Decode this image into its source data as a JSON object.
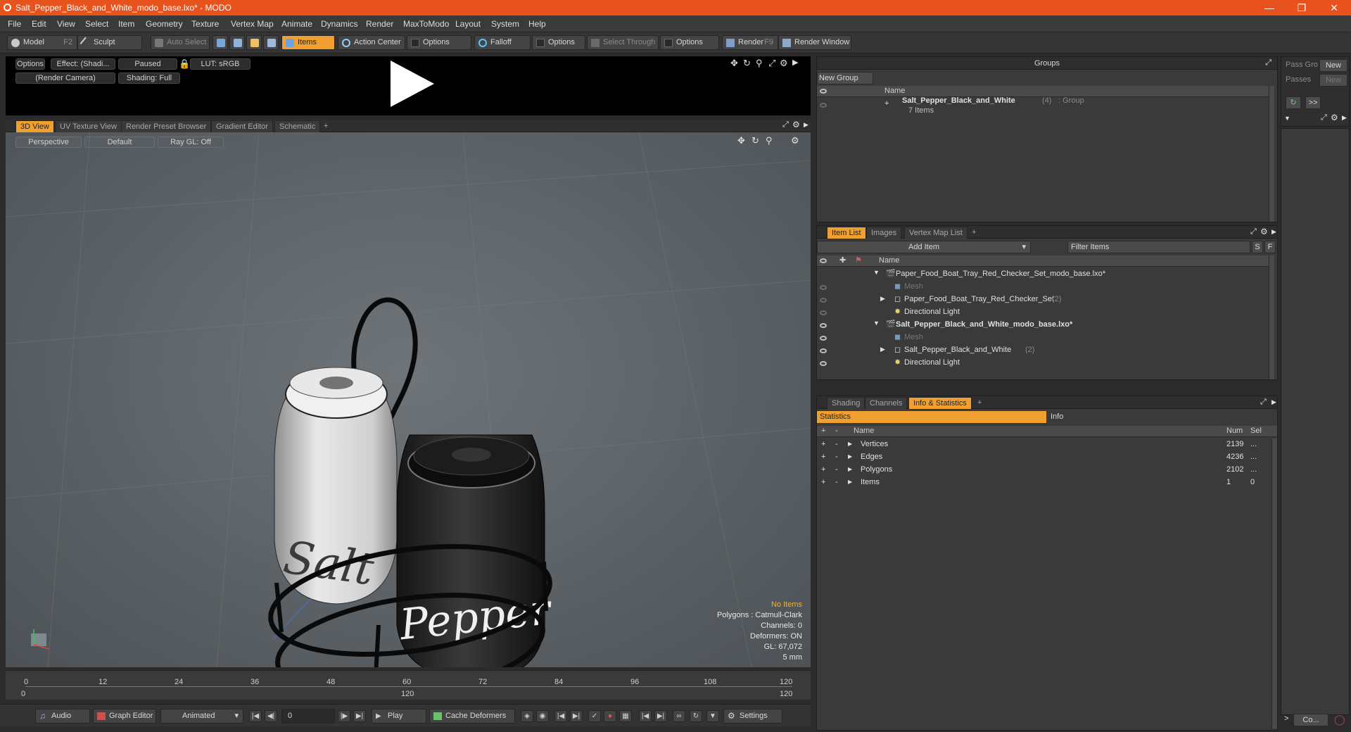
{
  "window": {
    "title": "Salt_Pepper_Black_and_White_modo_base.lxo* - MODO",
    "minimize": "—",
    "maximize": "❐",
    "close": "✕"
  },
  "menu": [
    "File",
    "Edit",
    "View",
    "Select",
    "Item",
    "Geometry",
    "Texture",
    "Vertex Map",
    "Animate",
    "Dynamics",
    "Render",
    "MaxToModo",
    "Layout",
    "System",
    "Help"
  ],
  "toolbar": {
    "model": "Model",
    "model_key": "F2",
    "sculpt": "Sculpt",
    "auto_select": "Auto Select",
    "items": "Items",
    "action_center": "Action Center",
    "options1": "Options",
    "falloff": "Falloff",
    "options2": "Options",
    "select_through": "Select Through",
    "options3": "Options",
    "render": "Render",
    "render_key": "F9",
    "render_window": "Render Window"
  },
  "preview": {
    "options": "Options",
    "effect": "Effect: (Shadi...",
    "paused": "Paused",
    "lut": "LUT: sRGB",
    "camera": "(Render Camera)",
    "shading": "Shading: Full"
  },
  "viewport_tabs": [
    "3D View",
    "UV Texture View",
    "Render Preset Browser",
    "Gradient Editor",
    "Schematic",
    "+"
  ],
  "viewport": {
    "perspective": "Perspective",
    "default": "Default",
    "raygl": "Ray GL: Off",
    "label_salt": "Salt",
    "label_pepper": "Pepper",
    "info": {
      "no_items": "No Items",
      "polygons": "Polygons : Catmull-Clark",
      "channels": "Channels: 0",
      "deformers": "Deformers: ON",
      "gl": "GL: 67,072",
      "unit": "5 mm"
    }
  },
  "timeline": {
    "ticks": [
      "0",
      "12",
      "24",
      "36",
      "48",
      "60",
      "72",
      "84",
      "96",
      "108",
      "120"
    ],
    "sub_left": "0",
    "sub_mid": "120",
    "sub_right": "120"
  },
  "bottombar": {
    "audio": "Audio",
    "graph_editor": "Graph Editor",
    "animated": "Animated",
    "frame": "0",
    "play": "Play",
    "cache_deformers": "Cache Deformers",
    "settings": "Settings"
  },
  "groups": {
    "title": "Groups",
    "new_group": "New Group",
    "col_name": "Name",
    "row_name": "Salt_Pepper_Black_and_White",
    "row_count": "(4)",
    "row_type": ": Group",
    "row_sub": "7 Items"
  },
  "pass": {
    "pass_groups": "Pass Gro",
    "passes": "Passes",
    "new1": "New",
    "new2": "New",
    "more": ">>"
  },
  "itemlist": {
    "tabs": [
      "Item List",
      "Images",
      "Vertex Map List",
      "+"
    ],
    "add_item": "Add Item",
    "filter": "Filter Items",
    "s": "S",
    "f": "F",
    "col_name": "Name",
    "rows": [
      {
        "label": "Paper_Food_Boat_Tray_Red_Checker_Set_modo_base.lxo*",
        "indent": 0,
        "bold": false,
        "dim": false,
        "arrow": "▼"
      },
      {
        "label": "Mesh",
        "indent": 1,
        "bold": false,
        "dim": true,
        "arrow": ""
      },
      {
        "label": "Paper_Food_Boat_Tray_Red_Checker_Set",
        "count": "(2)",
        "indent": 1,
        "bold": false,
        "dim": false,
        "arrow": "▶"
      },
      {
        "label": "Directional Light",
        "indent": 1,
        "bold": false,
        "dim": false,
        "arrow": ""
      },
      {
        "label": "Salt_Pepper_Black_and_White_modo_base.lxo*",
        "indent": 0,
        "bold": true,
        "dim": false,
        "arrow": "▼"
      },
      {
        "label": "Mesh",
        "indent": 1,
        "bold": false,
        "dim": true,
        "arrow": ""
      },
      {
        "label": "Salt_Pepper_Black_and_White",
        "count": "(2)",
        "indent": 1,
        "bold": false,
        "dim": false,
        "arrow": "▶"
      },
      {
        "label": "Directional Light",
        "indent": 1,
        "bold": false,
        "dim": false,
        "arrow": ""
      }
    ]
  },
  "stats": {
    "tabs": [
      "Shading",
      "Channels",
      "Info & Statistics",
      "+"
    ],
    "statistics": "Statistics",
    "info": "Info",
    "col_name": "Name",
    "col_num": "Num",
    "col_sel": "Sel",
    "plus": "+",
    "minus": "-",
    "rows": [
      {
        "name": "Vertices",
        "num": "2139",
        "sel": "..."
      },
      {
        "name": "Edges",
        "num": "4236",
        "sel": "..."
      },
      {
        "name": "Polygons",
        "num": "2102",
        "sel": "..."
      },
      {
        "name": "Items",
        "num": "1",
        "sel": "0"
      }
    ]
  },
  "far_right": {
    "co": "Co..."
  },
  "colors": {
    "accent": "#f0a030",
    "title_bar": "#e8521d"
  }
}
